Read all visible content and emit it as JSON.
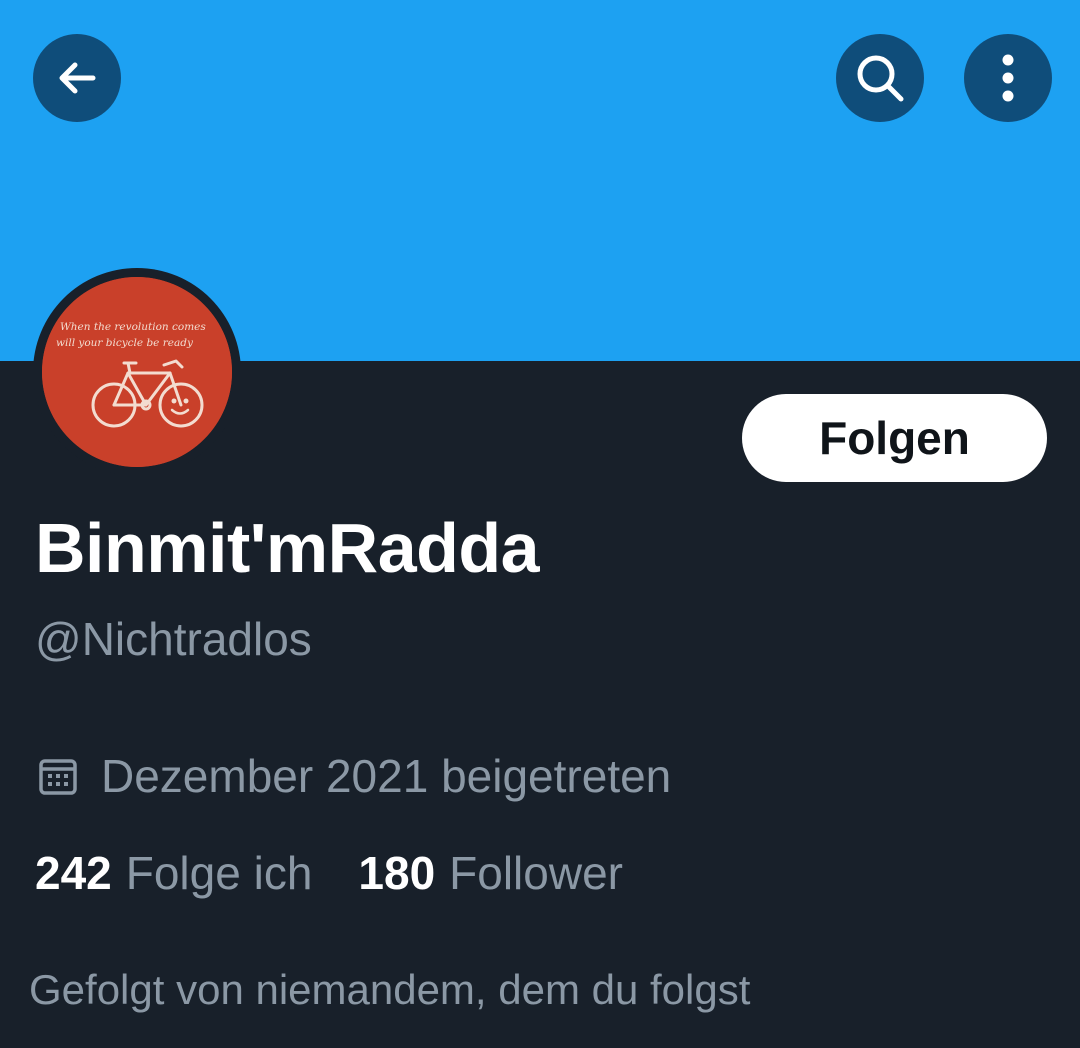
{
  "header": {
    "back_icon": "arrow-left-icon",
    "search_icon": "search-icon",
    "more_icon": "more-vertical-icon",
    "banner_color": "#1da1f2",
    "button_color": "#0f4d7a"
  },
  "avatar": {
    "background_color": "#c9402a",
    "text_line_1": "When the revolution comes",
    "text_line_2": "will your bicycle be ready"
  },
  "profile": {
    "follow_label": "Folgen",
    "display_name": "Binmit'mRadda",
    "handle": "@Nichtradlos",
    "joined_icon": "calendar-icon",
    "joined_text": "Dezember 2021 beigetreten",
    "following_count": "242",
    "following_label": "Folge ich",
    "followers_count": "180",
    "followers_label": "Follower",
    "followed_by_text": "Gefolgt von niemandem, dem du folgst"
  },
  "colors": {
    "page_background": "#18202a",
    "primary_text": "#ffffff",
    "secondary_text": "#8b98a5"
  }
}
